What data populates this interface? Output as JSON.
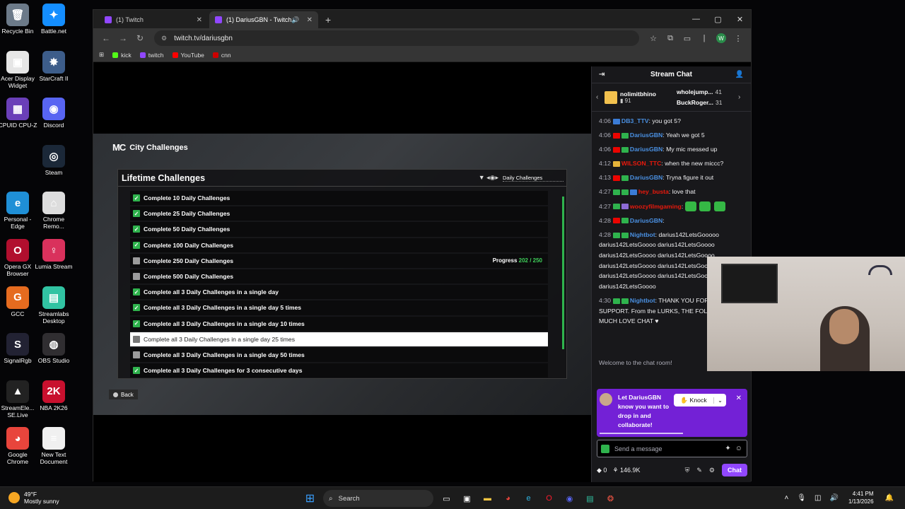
{
  "desktop_icons": [
    {
      "label": "Recycle Bin",
      "icon": "recycle-bin-icon",
      "color": "#6c7a89",
      "glyph": "🗑"
    },
    {
      "label": "Battle.net",
      "icon": "battlenet-icon",
      "color": "#148eff",
      "glyph": "✦"
    },
    {
      "label": "Acer Display Widget",
      "icon": "acer-icon",
      "color": "#e6e6e6",
      "glyph": "▣"
    },
    {
      "label": "StarCraft II",
      "icon": "starcraft-icon",
      "color": "#3d5d8a",
      "glyph": "✸"
    },
    {
      "label": "CPUID CPU-Z",
      "icon": "cpuz-icon",
      "color": "#6a3fb8",
      "glyph": "▦"
    },
    {
      "label": "Discord",
      "icon": "discord-icon",
      "color": "#5865f2",
      "glyph": "◉"
    },
    {
      "label": "Steam",
      "icon": "steam-icon",
      "color": "#1b2838",
      "glyph": "◎"
    },
    {
      "label": "Personal - Edge",
      "icon": "edge-icon",
      "color": "#1f8fd6",
      "glyph": "e"
    },
    {
      "label": "Chrome Remo...",
      "icon": "chrome-remote-icon",
      "color": "#dddddd",
      "glyph": "⌂"
    },
    {
      "label": "Opera GX Browser",
      "icon": "opera-gx-icon",
      "color": "#b10f2e",
      "glyph": "O"
    },
    {
      "label": "Lumia Stream",
      "icon": "lumia-icon",
      "color": "#d9315c",
      "glyph": "♀"
    },
    {
      "label": "GCC",
      "icon": "gcc-icon",
      "color": "#e56b1f",
      "glyph": "G"
    },
    {
      "label": "Streamlabs Desktop",
      "icon": "streamlabs-icon",
      "color": "#31c3a2",
      "glyph": "▤"
    },
    {
      "label": "SignalRgb",
      "icon": "signalrgb-icon",
      "color": "#222233",
      "glyph": "S"
    },
    {
      "label": "OBS Studio",
      "icon": "obs-icon",
      "color": "#302e31",
      "glyph": "◍"
    },
    {
      "label": "StreamEle... SE.Live",
      "icon": "streamelements-icon",
      "color": "#222222",
      "glyph": "▲"
    },
    {
      "label": "NBA 2K26",
      "icon": "nba2k-icon",
      "color": "#c8102e",
      "glyph": "2K"
    },
    {
      "label": "Google Chrome",
      "icon": "chrome-icon",
      "color": "#e8453c",
      "glyph": "◕"
    },
    {
      "label": "New Text Document",
      "icon": "text-document-icon",
      "color": "#f0f0f0",
      "glyph": "≡"
    }
  ],
  "browser": {
    "tabs": [
      {
        "title": "(1) Twitch",
        "active": false
      },
      {
        "title": "(1) DariusGBN - Twitch",
        "active": true
      }
    ],
    "url": "twitch.tv/dariusgbn",
    "profile_initial": "W",
    "bookmarks": [
      {
        "label": "kick",
        "color": "#53fc18"
      },
      {
        "label": "twitch",
        "color": "#9147ff"
      },
      {
        "label": "YouTube",
        "color": "#ff0000"
      },
      {
        "label": "cnn",
        "color": "#cc0000"
      }
    ]
  },
  "game": {
    "header": "City Challenges",
    "logo": "MC",
    "panel_title": "Lifetime Challenges",
    "filter_label": "Daily Challenges",
    "back_label": "Back",
    "challenges": [
      {
        "label": "Complete 10 Daily Challenges",
        "done": true
      },
      {
        "label": "Complete 25 Daily Challenges",
        "done": true
      },
      {
        "label": "Complete 50 Daily Challenges",
        "done": true
      },
      {
        "label": "Complete 100 Daily Challenges",
        "done": true
      },
      {
        "label": "Complete 250 Daily Challenges",
        "done": false,
        "progress_label": "Progress",
        "progress_value": "202 / 250"
      },
      {
        "label": "Complete 500 Daily Challenges",
        "done": false
      },
      {
        "label": "Complete all 3 Daily Challenges in a single day",
        "done": true
      },
      {
        "label": "Complete all 3 Daily Challenges in a single day 5 times",
        "done": true
      },
      {
        "label": "Complete all 3 Daily Challenges in a single day 10 times",
        "done": true
      },
      {
        "label": "Complete all 3 Daily Challenges in a single day 25 times",
        "done": false,
        "selected": true
      },
      {
        "label": "Complete all 3 Daily Challenges in a single day 50 times",
        "done": false
      },
      {
        "label": "Complete all 3 Daily Challenges for 3 consecutive days",
        "done": true
      }
    ]
  },
  "chat": {
    "title": "Stream Chat",
    "gifters": {
      "main": {
        "name": "nolimitbhino",
        "count": "91"
      },
      "side": [
        {
          "name": "wholejump...",
          "count": "41"
        },
        {
          "name": "BuckRoger...",
          "count": "31"
        }
      ]
    },
    "messages": [
      {
        "time": "4:06",
        "badges": [
          "blue"
        ],
        "user": "DB3_TTV",
        "color": "#4a90e2",
        "text": ": you got 5?"
      },
      {
        "time": "4:06",
        "badges": [
          "red",
          "green"
        ],
        "user": "DariusGBN",
        "color": "#4a90e2",
        "text": ": Yeah we got 5"
      },
      {
        "time": "4:06",
        "badges": [
          "red",
          "green"
        ],
        "user": "DariusGBN",
        "color": "#4a90e2",
        "text": ": My mic messed up"
      },
      {
        "time": "4:12",
        "badges": [
          "yellow"
        ],
        "user": "WILSON_TTC",
        "color": "#e8190c",
        "text": ": when the new miccc?"
      },
      {
        "time": "4:13",
        "badges": [
          "red",
          "green"
        ],
        "user": "DariusGBN",
        "color": "#4a90e2",
        "text": ": Tryna figure it out"
      },
      {
        "time": "4:27",
        "badges": [
          "green",
          "green",
          "blue"
        ],
        "user": "hey_busta",
        "color": "#e8190c",
        "text": ": love that"
      },
      {
        "time": "4:27",
        "badges": [
          "green",
          "sub"
        ],
        "user": "woozyfilmgaming",
        "color": "#e8190c",
        "text": ":",
        "emotes": 3
      },
      {
        "time": "4:28",
        "badges": [
          "red",
          "green"
        ],
        "user": "DariusGBN",
        "color": "#4a90e2",
        "text": ":",
        "emotes": 0
      },
      {
        "time": "4:28",
        "badges": [
          "green",
          "green"
        ],
        "user": "Nightbot",
        "color": "#4a90e2",
        "text": ": darius142LetsGooooo darius142LetsGoooo darius142LetsGoooo darius142LetsGoooo darius142LetsGoooo darius142LetsGoooo darius142LetsGoooo darius142LetsGoooo darius142LetsGoooo darius142LetsGoooo"
      },
      {
        "time": "4:30",
        "badges": [
          "green",
          "green"
        ],
        "user": "Nightbot",
        "color": "#4a90e2",
        "text": ": THANK YOU FOR ALL your SUPPORT. From the LURKS, THE FOLLOWS! MUCH LOVE CHAT ♥"
      }
    ],
    "welcome": "Welcome to the chat room!",
    "collab": {
      "text": "Let DariusGBN know you want to drop in and collaborate!",
      "button": "Knock"
    },
    "input_placeholder": "Send a message",
    "points": "0",
    "channel_points": "146.9K",
    "send_label": "Chat"
  },
  "taskbar": {
    "weather_temp": "49°F",
    "weather_desc": "Mostly sunny",
    "search_label": "Search",
    "time": "4:41 PM",
    "date": "1/13/2026"
  }
}
